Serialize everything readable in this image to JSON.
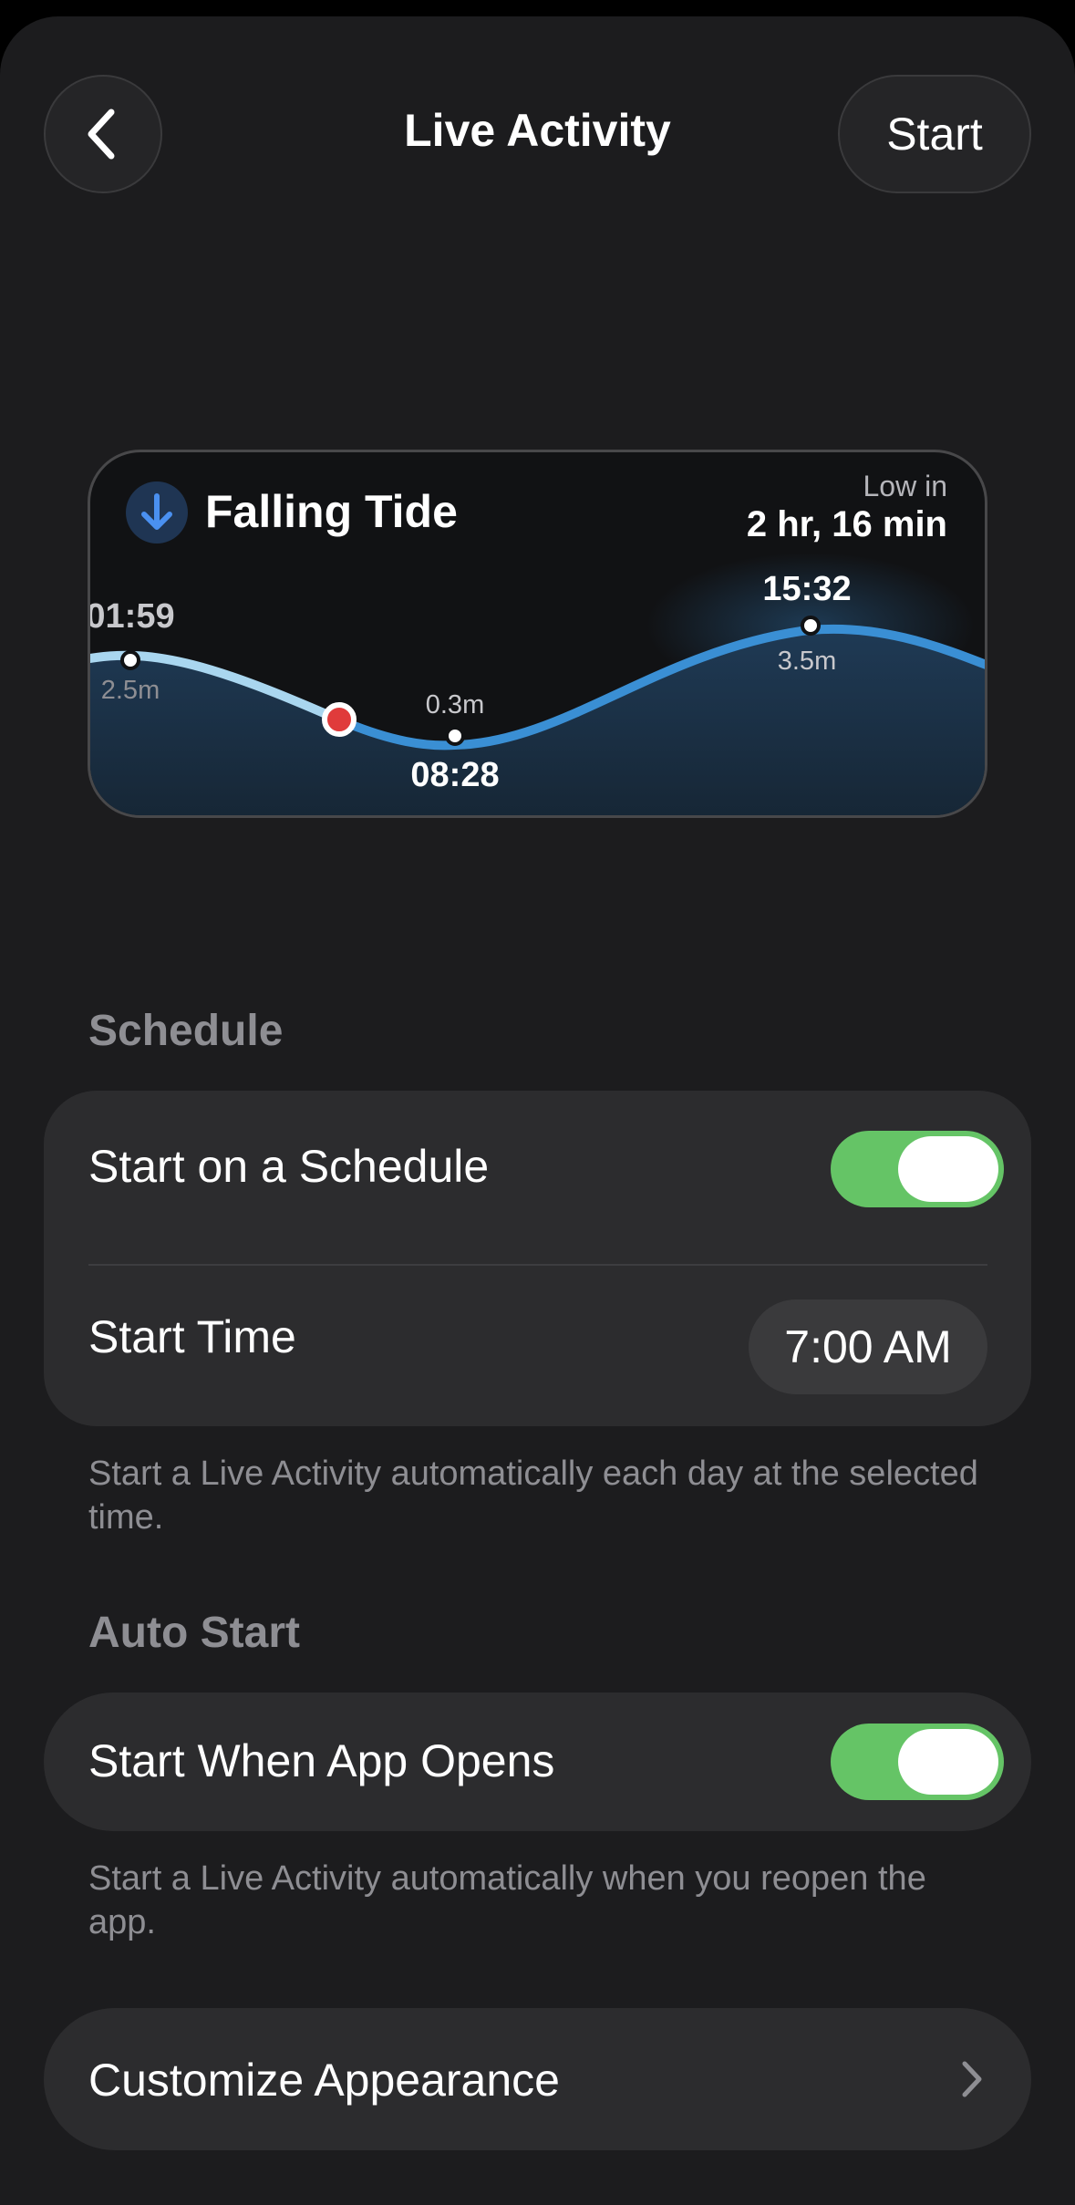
{
  "nav": {
    "title": "Live Activity",
    "start_label": "Start"
  },
  "widget": {
    "status": "Falling Tide",
    "low_in_label": "Low in",
    "low_in_value": "2 hr, 16 min",
    "points": [
      {
        "time": "01:59",
        "height": "2.5m"
      },
      {
        "time": "08:28",
        "height": "0.3m"
      },
      {
        "time": "15:32",
        "height": "3.5m"
      }
    ],
    "colors": {
      "curve_past": "#a9d6ef",
      "curve_future": "#3a8fd4",
      "now_marker": "#e03b3b",
      "arrow_bg": "#1f3553",
      "arrow": "#4a90f0"
    }
  },
  "schedule": {
    "header": "Schedule",
    "start_on_schedule_label": "Start on a Schedule",
    "start_on_schedule_on": true,
    "start_time_label": "Start Time",
    "start_time_value": "7:00 AM",
    "footnote": "Start a Live Activity automatically each day at the selected time."
  },
  "auto_start": {
    "header": "Auto Start",
    "start_when_opens_label": "Start When App Opens",
    "start_when_opens_on": true,
    "footnote": "Start a Live Activity automatically when you reopen the app."
  },
  "customize": {
    "label": "Customize Appearance"
  },
  "accent": {
    "toggle_on": "#65c466"
  }
}
